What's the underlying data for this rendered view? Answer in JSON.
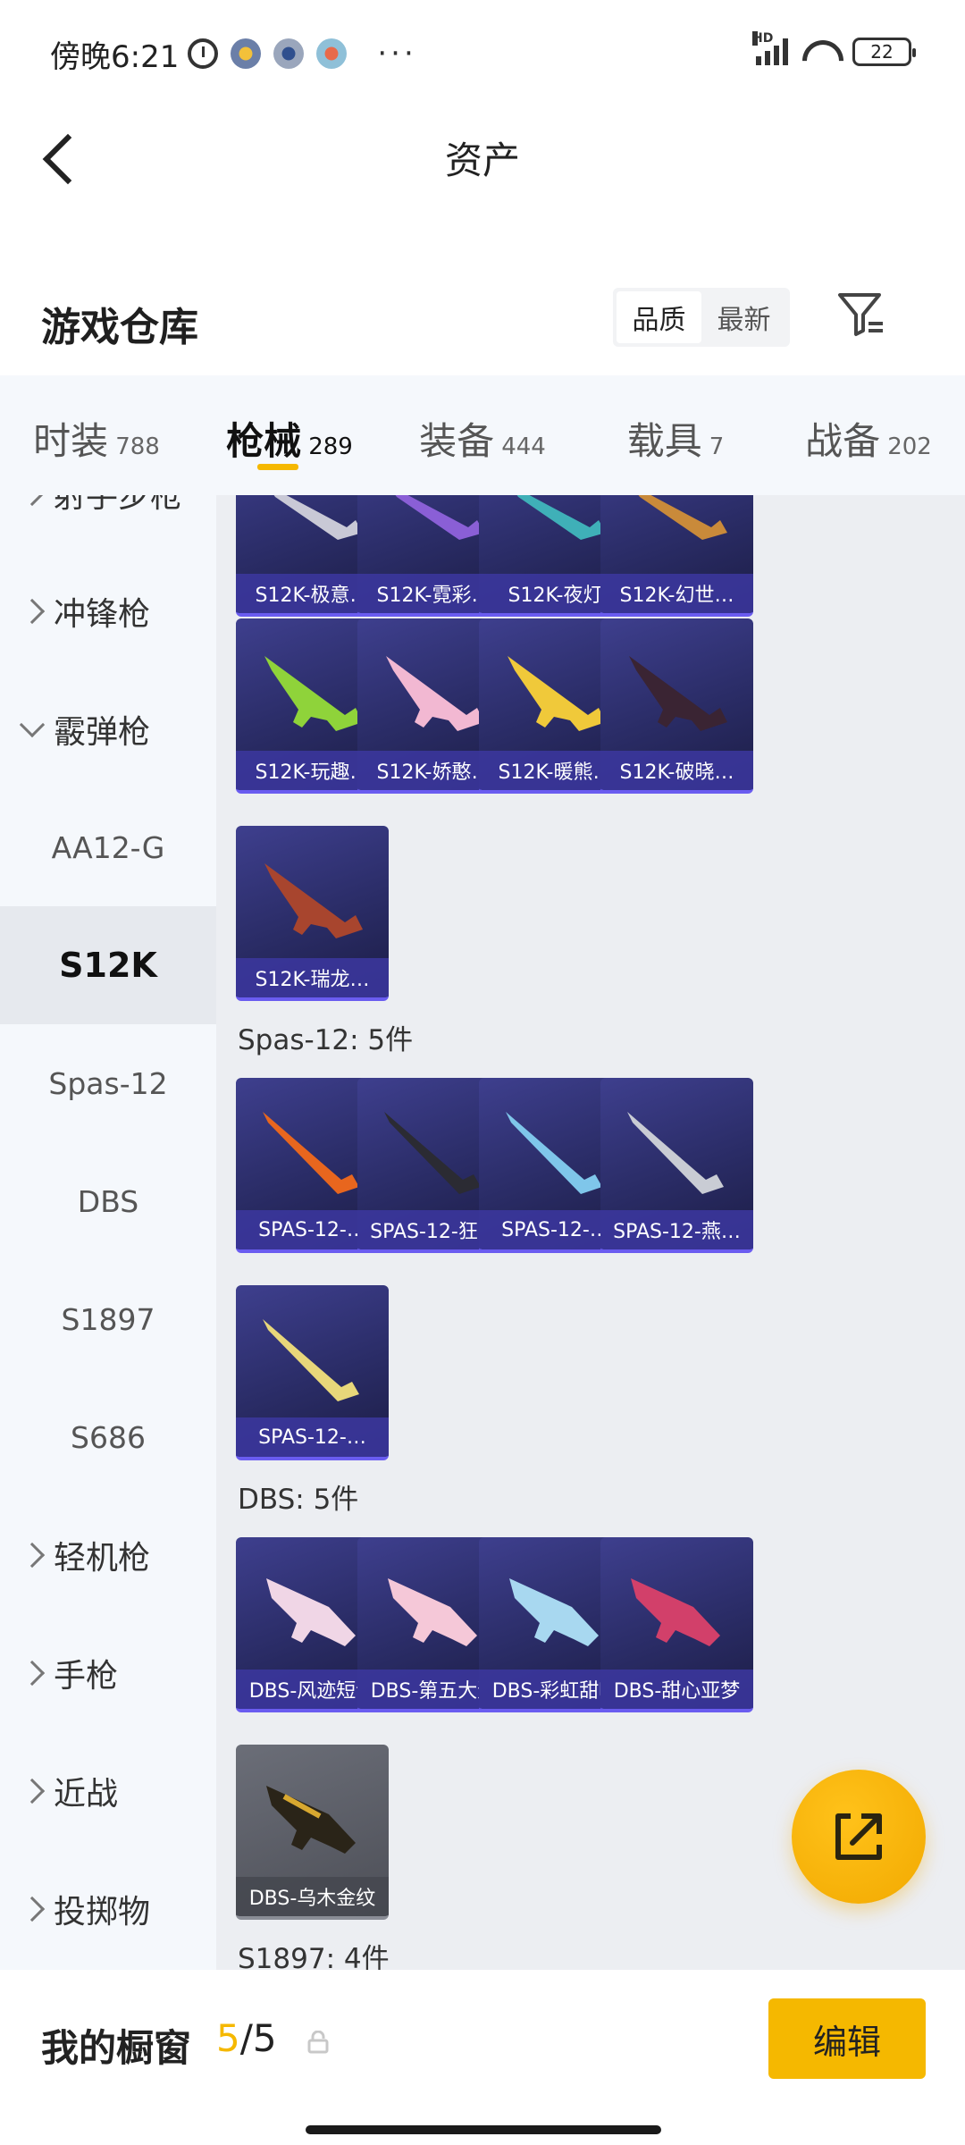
{
  "status_bar": {
    "time": "傍晚6:21",
    "more": "···",
    "network": "HD",
    "battery": "22"
  },
  "header": {
    "title": "资产"
  },
  "warehouse": {
    "title": "游戏仓库",
    "sort_options": [
      "品质",
      "最新"
    ],
    "active_sort": "品质"
  },
  "tabs": [
    {
      "label": "时装",
      "count": "788"
    },
    {
      "label": "枪械",
      "count": "289"
    },
    {
      "label": "装备",
      "count": "444"
    },
    {
      "label": "载具",
      "count": "7"
    },
    {
      "label": "战备",
      "count": "202"
    }
  ],
  "sidebar": {
    "items": [
      {
        "label": "射手步枪",
        "type": "category"
      },
      {
        "label": "冲锋枪",
        "type": "category"
      },
      {
        "label": "霰弹枪",
        "type": "category-open"
      },
      {
        "label": "AA12-G",
        "type": "sub"
      },
      {
        "label": "S12K",
        "type": "sub-selected"
      },
      {
        "label": "Spas-12",
        "type": "sub"
      },
      {
        "label": "DBS",
        "type": "sub"
      },
      {
        "label": "S1897",
        "type": "sub"
      },
      {
        "label": "S686",
        "type": "sub"
      },
      {
        "label": "轻机枪",
        "type": "category"
      },
      {
        "label": "手枪",
        "type": "category"
      },
      {
        "label": "近战",
        "type": "category"
      },
      {
        "label": "投掷物",
        "type": "category"
      }
    ]
  },
  "content": {
    "s12k_row1": [
      "S12K-极意…",
      "S12K-霓彩…",
      "S12K-夜灯",
      "S12K-幻世…"
    ],
    "s12k_row2": [
      "S12K-玩趣…",
      "S12K-娇憨…",
      "S12K-暖熊…",
      "S12K-破晓…"
    ],
    "s12k_row3": [
      "S12K-瑞龙…"
    ],
    "spas_header": "Spas-12: 5件",
    "spas_row1": [
      "SPAS-12-…",
      "SPAS-12-狂…",
      "SPAS-12-…",
      "SPAS-12-燕…"
    ],
    "spas_row2": [
      "SPAS-12-…"
    ],
    "dbs_header": "DBS: 5件",
    "dbs_row1": [
      "DBS-风迹短诗",
      "DBS-第五大道",
      "DBS-彩虹甜喵",
      "DBS-甜心亚梦"
    ],
    "dbs_row2": [
      "DBS-乌木金纹"
    ],
    "s1897_header": "S1897: 4件"
  },
  "bottom": {
    "showcase_label": "我的橱窗",
    "current": "5",
    "separator": "/",
    "total": "5",
    "edit": "编辑"
  },
  "colors": {
    "accent": "#f5b800",
    "card_bg": "#2a2c66",
    "sidebar_bg": "#f5f8fc"
  }
}
